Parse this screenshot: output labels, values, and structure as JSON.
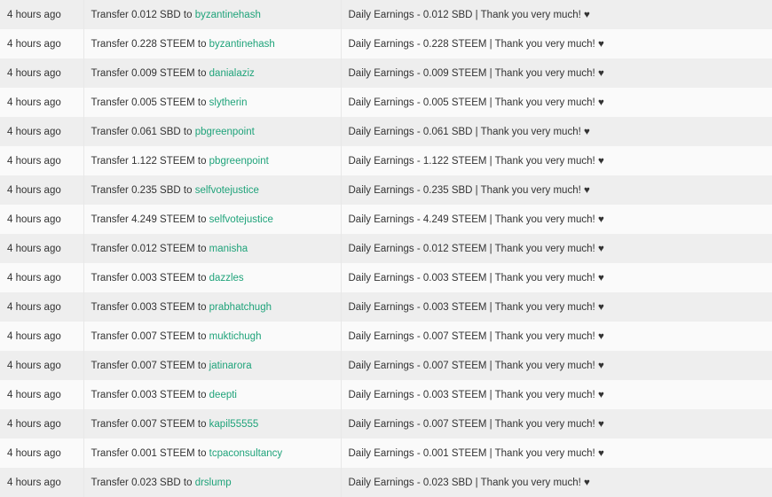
{
  "transfers": [
    {
      "time": "4 hours ago",
      "prefix": "Transfer 0.012 SBD to ",
      "recipient": "byzantinehash",
      "memo": "Daily Earnings - 0.012 SBD | Thank you very much! ♥"
    },
    {
      "time": "4 hours ago",
      "prefix": "Transfer 0.228 STEEM to ",
      "recipient": "byzantinehash",
      "memo": "Daily Earnings - 0.228 STEEM | Thank you very much! ♥"
    },
    {
      "time": "4 hours ago",
      "prefix": "Transfer 0.009 STEEM to ",
      "recipient": "danialaziz",
      "memo": "Daily Earnings - 0.009 STEEM | Thank you very much! ♥"
    },
    {
      "time": "4 hours ago",
      "prefix": "Transfer 0.005 STEEM to ",
      "recipient": "slytherin",
      "memo": "Daily Earnings - 0.005 STEEM | Thank you very much! ♥"
    },
    {
      "time": "4 hours ago",
      "prefix": "Transfer 0.061 SBD to ",
      "recipient": "pbgreenpoint",
      "memo": "Daily Earnings - 0.061 SBD | Thank you very much! ♥"
    },
    {
      "time": "4 hours ago",
      "prefix": "Transfer 1.122 STEEM to ",
      "recipient": "pbgreenpoint",
      "memo": "Daily Earnings - 1.122 STEEM | Thank you very much! ♥"
    },
    {
      "time": "4 hours ago",
      "prefix": "Transfer 0.235 SBD to ",
      "recipient": "selfvotejustice",
      "memo": "Daily Earnings - 0.235 SBD | Thank you very much! ♥"
    },
    {
      "time": "4 hours ago",
      "prefix": "Transfer 4.249 STEEM to ",
      "recipient": "selfvotejustice",
      "memo": "Daily Earnings - 4.249 STEEM | Thank you very much! ♥"
    },
    {
      "time": "4 hours ago",
      "prefix": "Transfer 0.012 STEEM to ",
      "recipient": "manisha",
      "memo": "Daily Earnings - 0.012 STEEM | Thank you very much! ♥"
    },
    {
      "time": "4 hours ago",
      "prefix": "Transfer 0.003 STEEM to ",
      "recipient": "dazzles",
      "memo": "Daily Earnings - 0.003 STEEM | Thank you very much! ♥"
    },
    {
      "time": "4 hours ago",
      "prefix": "Transfer 0.003 STEEM to ",
      "recipient": "prabhatchugh",
      "memo": "Daily Earnings - 0.003 STEEM | Thank you very much! ♥"
    },
    {
      "time": "4 hours ago",
      "prefix": "Transfer 0.007 STEEM to ",
      "recipient": "muktichugh",
      "memo": "Daily Earnings - 0.007 STEEM | Thank you very much! ♥"
    },
    {
      "time": "4 hours ago",
      "prefix": "Transfer 0.007 STEEM to ",
      "recipient": "jatinarora",
      "memo": "Daily Earnings - 0.007 STEEM | Thank you very much! ♥"
    },
    {
      "time": "4 hours ago",
      "prefix": "Transfer 0.003 STEEM to ",
      "recipient": "deepti",
      "memo": "Daily Earnings - 0.003 STEEM | Thank you very much! ♥"
    },
    {
      "time": "4 hours ago",
      "prefix": "Transfer 0.007 STEEM to ",
      "recipient": "kapil55555",
      "memo": "Daily Earnings - 0.007 STEEM | Thank you very much! ♥"
    },
    {
      "time": "4 hours ago",
      "prefix": "Transfer 0.001 STEEM to ",
      "recipient": "tcpaconsultancy",
      "memo": "Daily Earnings - 0.001 STEEM | Thank you very much! ♥"
    },
    {
      "time": "4 hours ago",
      "prefix": "Transfer 0.023 SBD to ",
      "recipient": "drslump",
      "memo": "Daily Earnings - 0.023 SBD | Thank you very much! ♥"
    }
  ],
  "colors": {
    "link": "#1fa37a",
    "row_odd": "#eeeeee",
    "row_even": "#fafafa",
    "text": "#333333"
  }
}
